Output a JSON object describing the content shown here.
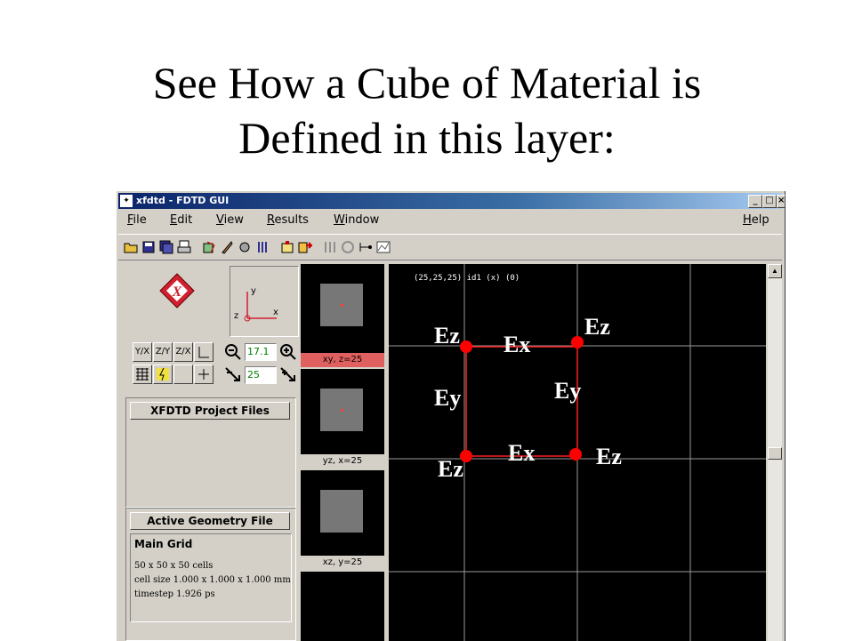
{
  "slide": {
    "title_line1": "See How a Cube of Material is",
    "title_line2": "Defined in this layer:"
  },
  "window": {
    "title": "xfdtd - FDTD GUI",
    "minimize": "_",
    "maximize": "□",
    "close": "×",
    "menus": [
      "File",
      "Edit",
      "View",
      "Results",
      "Window"
    ],
    "help_menu": "Help"
  },
  "toolbar_icons": [
    "open-folder-icon",
    "save-icon",
    "save-all-icon",
    "print-icon",
    "mesh-icon",
    "material-icon",
    "probe-icon",
    "source-icon",
    "geometry-icon",
    "run-icon",
    "stop-icon",
    "align-icon",
    "graph-icon",
    "plot-icon"
  ],
  "left": {
    "logo_text": "X",
    "axis_y": "y",
    "axis_x": "x",
    "axis_z": "z",
    "plane_buttons": [
      "Y/X",
      "Z/Y",
      "Z/X"
    ],
    "zoom_value": "17.1",
    "step_value": "25",
    "project_files_header": "XFDTD Project Files",
    "geometry_header": "Active Geometry File",
    "grid_name": "Main Grid",
    "grid_cells": "50 x 50 x 50 cells",
    "cell_size": "cell size 1.000 x 1.000 x 1.000 mm",
    "timestep": "timestep 1.926 ps"
  },
  "views": [
    {
      "label": "xy, z=25",
      "active": true
    },
    {
      "label": "yz, x=25",
      "active": false
    },
    {
      "label": "xz, y=25",
      "active": false
    }
  ],
  "viewport": {
    "readout": "(25,25,25)  id1  (x)  (0)",
    "labels": {
      "ez_tl": "Ez",
      "ez_tr": "Ez",
      "ez_bl": "Ez",
      "ez_br": "Ez",
      "ex_top": "Ex",
      "ex_bottom": "Ex",
      "ey_left": "Ey",
      "ey_right": "Ey"
    },
    "colors": {
      "cell_edge": "#ff2020",
      "grid": "#9a9a9a",
      "node": "#ff0000"
    }
  }
}
